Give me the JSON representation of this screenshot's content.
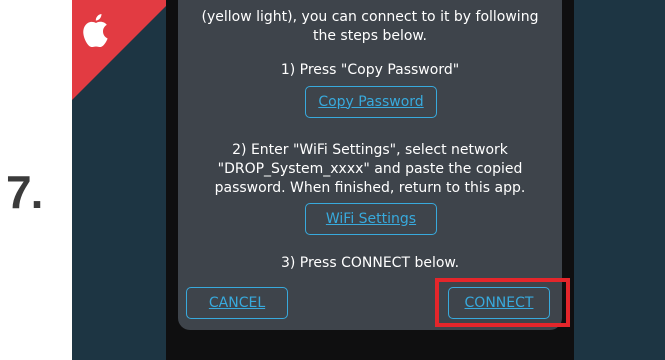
{
  "step_number": "7.",
  "platform_icon": "apple-icon",
  "colors": {
    "background": "#1d3543",
    "ribbon": "#e23b42",
    "dialog": "#3e444b",
    "accent": "#38aadd",
    "highlight": "#e4262b"
  },
  "dialog": {
    "intro_line1": "(yellow light), you can connect to it by following",
    "intro_line2": "the steps below.",
    "step1": "1) Press \"Copy Password\"",
    "copy_password_label": "Copy Password",
    "step2_line1": "2) Enter \"WiFi Settings\", select network",
    "step2_line2": "\"DROP_System_xxxx\" and paste the copied",
    "step2_line3": "password.  When finished, return to this app.",
    "wifi_settings_label": "WiFi Settings",
    "step3": "3) Press CONNECT below.",
    "cancel_label": "CANCEL",
    "connect_label": "CONNECT"
  }
}
